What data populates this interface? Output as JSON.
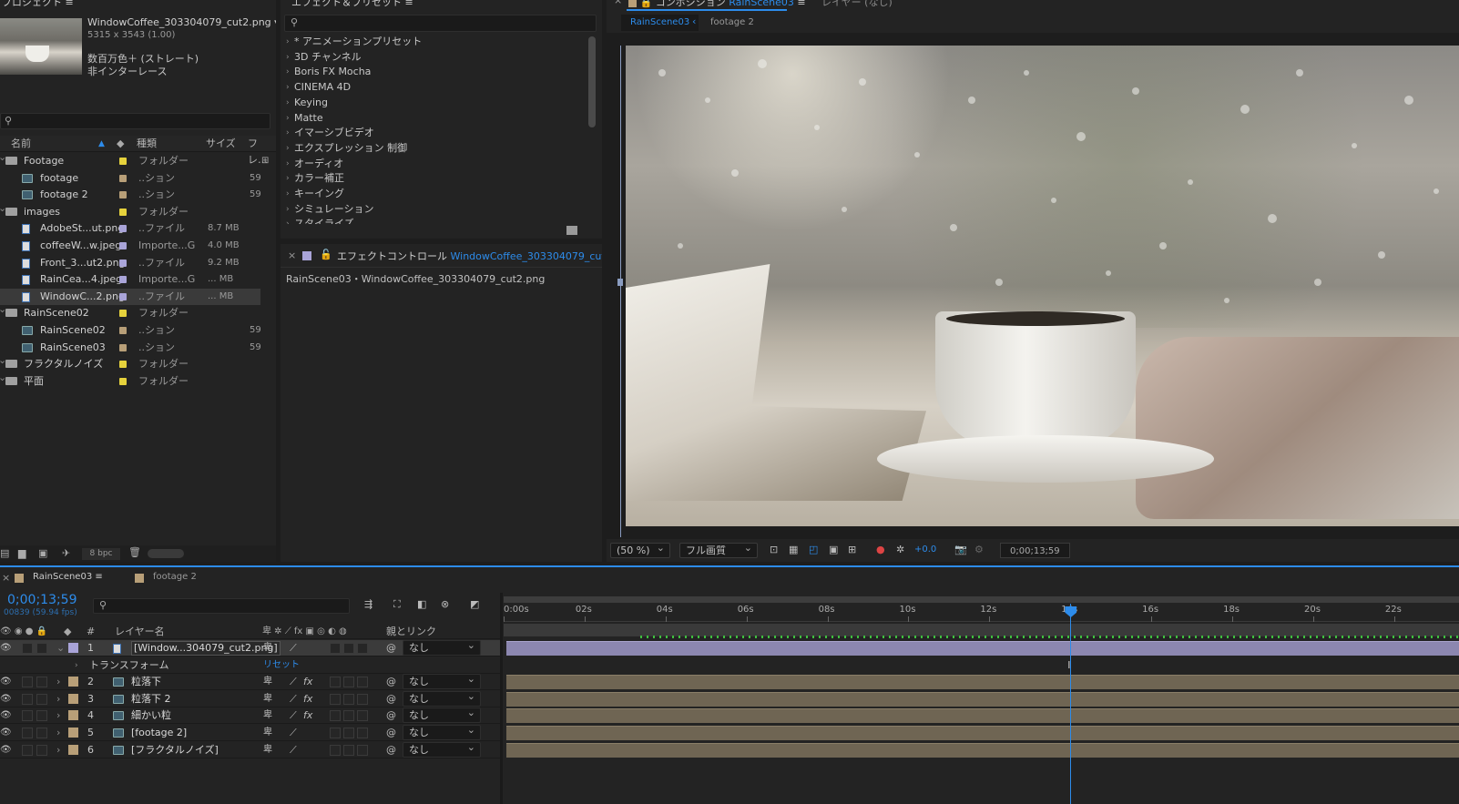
{
  "project": {
    "title": "プロジェクト",
    "file_name": "WindowCoffee_303304079_cut2.png ▾",
    "dims": "5315 x 3543 (1.00)",
    "color": "数百万色＋ (ストレート)",
    "interlace": "非インターレース",
    "search_placeholder": "",
    "columns": {
      "name": "名前",
      "type": "種類",
      "size": "サイズ",
      "frame": "フレ…"
    },
    "items": [
      {
        "name": "Footage",
        "type": "フォルダー",
        "size": "",
        "kind": "folder",
        "depth": 0,
        "color": "#e6d23c"
      },
      {
        "name": "footage",
        "type": "..ション",
        "size": "59",
        "kind": "comp",
        "depth": 1,
        "color": "#b89f78"
      },
      {
        "name": "footage 2",
        "type": "..ション",
        "size": "59",
        "kind": "comp",
        "depth": 1,
        "color": "#b89f78"
      },
      {
        "name": "images",
        "type": "フォルダー",
        "size": "",
        "kind": "folder",
        "depth": 0,
        "color": "#e6d23c"
      },
      {
        "name": "AdobeSt...ut.png",
        "type": "..ファイル",
        "size": "8.7 MB",
        "kind": "file",
        "depth": 1,
        "color": "#a9a4d8"
      },
      {
        "name": "coffeeW...w.jpeg",
        "type": "Importe...G",
        "size": "4.0 MB",
        "kind": "file",
        "depth": 1,
        "color": "#a9a4d8"
      },
      {
        "name": "Front_3...ut2.png",
        "type": "..ファイル",
        "size": "9.2 MB",
        "kind": "file",
        "depth": 1,
        "color": "#a9a4d8"
      },
      {
        "name": "RainCea...4.jpeg",
        "type": "Importe...G",
        "size": "... MB",
        "kind": "file",
        "depth": 1,
        "color": "#a9a4d8"
      },
      {
        "name": "WindowC...2.png",
        "type": "..ファイル",
        "size": "... MB",
        "kind": "file",
        "depth": 1,
        "color": "#a9a4d8"
      },
      {
        "name": "RainScene02",
        "type": "フォルダー",
        "size": "",
        "kind": "folder",
        "depth": 0,
        "color": "#e6d23c"
      },
      {
        "name": "RainScene02",
        "type": "..ション",
        "size": "59",
        "kind": "comp",
        "depth": 1,
        "color": "#b89f78"
      },
      {
        "name": "RainScene03",
        "type": "..ション",
        "size": "59",
        "kind": "comp",
        "depth": 1,
        "color": "#b89f78"
      },
      {
        "name": "フラクタルノイズ",
        "type": "フォルダー",
        "size": "",
        "kind": "folder",
        "depth": 0,
        "color": "#e6d23c"
      },
      {
        "name": "平面",
        "type": "フォルダー",
        "size": "",
        "kind": "folder",
        "depth": 0,
        "color": "#e6d23c"
      }
    ],
    "bpc": "8 bpc"
  },
  "effects": {
    "title": "エフェクト＆プリセット",
    "items": [
      "* アニメーションプリセット",
      "3D チャンネル",
      "Boris FX Mocha",
      "CINEMA 4D",
      "Keying",
      "Matte",
      "イマーシブビデオ",
      "エクスプレッション 制御",
      "オーディオ",
      "カラー補正",
      "キーイング",
      "シミュレーション",
      "スタイライズ"
    ]
  },
  "effect_controls": {
    "title": "エフェクトコントロール",
    "file": "WindowCoffee_303304079_cut2.png",
    "path": "RainScene03・WindowCoffee_303304079_cut2.png"
  },
  "composition": {
    "title": "コンポジション",
    "active": "RainScene03",
    "layer_tab": "レイヤー (なし)",
    "subtabs": [
      "RainScene03",
      "footage 2"
    ],
    "zoom": "(50 %)",
    "quality": "フル画質",
    "exposure": "+0.0",
    "timecode": "0;00;13;59"
  },
  "timeline": {
    "tabs": [
      "RainScene03",
      "footage 2"
    ],
    "timecode": "0;00;13;59",
    "frames": "00839 (59.94 fps)",
    "col_layer": "レイヤー名",
    "col_num": "#",
    "col_parent": "親とリンク",
    "ruler": [
      "0:00s",
      "02s",
      "04s",
      "06s",
      "08s",
      "10s",
      "12s",
      "14s",
      "16s",
      "18s",
      "20s",
      "22s"
    ],
    "transform": "トランスフォーム",
    "reset": "リセット",
    "layers": [
      {
        "num": "1",
        "name": "[Window...304079_cut2.png]",
        "fx": "",
        "parent": "なし",
        "color": "#a9a4d8",
        "expanded": "⌄"
      },
      {
        "num": "2",
        "name": "粒落下",
        "fx": "fx",
        "parent": "なし",
        "color": "#b89f78",
        "expanded": "›"
      },
      {
        "num": "3",
        "name": "粒落下 2",
        "fx": "fx",
        "parent": "なし",
        "color": "#b89f78",
        "expanded": "›"
      },
      {
        "num": "4",
        "name": "細かい粒",
        "fx": "fx",
        "parent": "なし",
        "color": "#b89f78",
        "expanded": "›"
      },
      {
        "num": "5",
        "name": "[footage 2]",
        "fx": "",
        "parent": "なし",
        "color": "#b89f78",
        "expanded": "›"
      },
      {
        "num": "6",
        "name": "[フラクタルノイズ]",
        "fx": "",
        "parent": "なし",
        "color": "#b89f78",
        "expanded": "›"
      }
    ],
    "playhead_time_s": 14,
    "duration_s": 23.6
  }
}
